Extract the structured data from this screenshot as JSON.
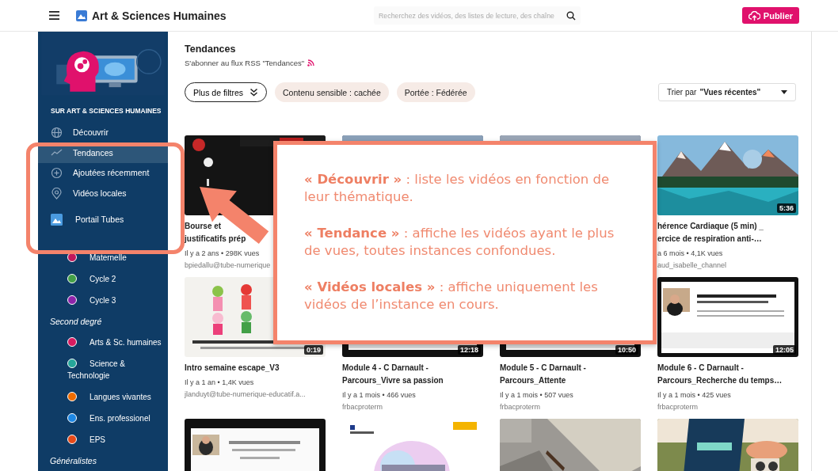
{
  "header": {
    "title": "Art & Sciences Humaines",
    "search": {
      "placeholder": "Recherchez des vidéos, des listes de lecture, des chaîne"
    },
    "publish_button": "Publier"
  },
  "sidebar": {
    "heading": "SUR ART & SCIENCES HUMAINES",
    "nav": [
      {
        "kind": "discover",
        "label": "Découvrir",
        "selected": false
      },
      {
        "kind": "trending",
        "label": "Tendances",
        "selected": true
      },
      {
        "kind": "recent",
        "label": "Ajoutées récemment",
        "selected": false
      },
      {
        "kind": "local",
        "label": "Vidéos locales",
        "selected": false
      },
      {
        "kind": "portal",
        "label": "Portail Tubes",
        "selected": false
      }
    ],
    "groups": [
      {
        "items": [
          {
            "label": "Maternelle",
            "color": "#c2185b"
          },
          {
            "label": "Cycle 2",
            "color": "#43a047"
          },
          {
            "label": "Cycle 3",
            "color": "#8e24aa"
          }
        ]
      },
      {
        "title": "Second degré",
        "items": [
          {
            "label": "Arts & Sc. humaines",
            "color": "#d81b60"
          },
          {
            "label": "Science & Technologie",
            "color": "#26a69a"
          },
          {
            "label": "Langues vivantes",
            "color": "#ef6c00"
          },
          {
            "label": "Ens. professionel",
            "color": "#1e88e5"
          },
          {
            "label": "EPS",
            "color": "#e64a19"
          }
        ]
      },
      {
        "title": "Généralistes"
      }
    ]
  },
  "page": {
    "title": "Tendances",
    "rss_link": "S'abonner au flux RSS \"Tendances\"",
    "filters_button": "Plus de filtres",
    "chips": [
      "Contenu sensible : cachée",
      "Portée : Fédérée"
    ],
    "sort": {
      "label": "Trier par",
      "value": "\"Vues récentes\""
    }
  },
  "videos": [
    {
      "kind": "video",
      "title_lines": [
        "Bourse et",
        "justificatifs prép"
      ],
      "meta": "Il y a 2 ans • 298K vues",
      "channel": "bpiedallu@tube-numerique"
    },
    {
      "kind": "picture"
    },
    {
      "kind": "picture"
    },
    {
      "kind": "video",
      "duration": "5:36",
      "title_lines": [
        "hérence Cardiaque (5 min) _",
        "ercice de respiration anti-…"
      ],
      "meta": "a 6 mois • 4,1K vues",
      "channel": "aud_isabelle_channel"
    },
    {
      "kind": "video",
      "duration": "0:19",
      "title_lines": [
        "Intro semaine escape_V3"
      ],
      "meta": "Il y a 1 an • 1,4K vues",
      "channel": "jlanduyt@tube-numerique-educatif.a..."
    },
    {
      "kind": "video",
      "duration": "12:18",
      "title_lines": [
        "Module 4 - C Darnault -",
        "Parcours_Vivre sa passion"
      ],
      "meta": "Il y a 1 mois • 466 vues",
      "channel": "frbacproterm"
    },
    {
      "kind": "video",
      "duration": "10:50",
      "title_lines": [
        "Module 5 - C Darnault -",
        "Parcours_Attente"
      ],
      "meta": "Il y a 1 mois • 507 vues",
      "channel": "frbacproterm"
    },
    {
      "kind": "video",
      "duration": "12:05",
      "title_lines": [
        "Module 6 - C Darnault -",
        "Parcours_Recherche du temps…"
      ],
      "meta": "Il y a 1 mois • 425 vues",
      "channel": "frbacproterm"
    },
    {
      "kind": "picture"
    },
    {
      "kind": "picture"
    },
    {
      "kind": "picture"
    },
    {
      "kind": "picture"
    }
  ],
  "callout": {
    "paragraphs": [
      "**« Découvrir »** : liste les vidéos en fonction de leur thématique.",
      "**« Tendance »** : affiche les vidéos ayant le plus de vues, toutes instances confondues.",
      "**« Vidéos locales »** : affiche uniquement les vidéos de l’instance en cours."
    ]
  }
}
